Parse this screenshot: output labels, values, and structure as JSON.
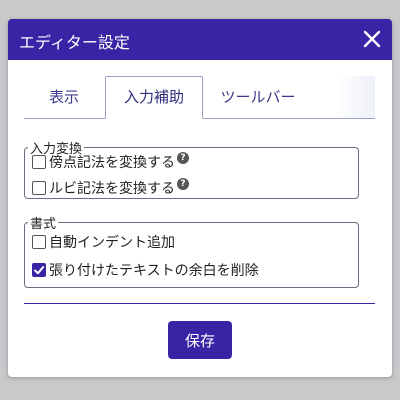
{
  "dialog": {
    "title": "エディター設定",
    "close_icon": "close-icon"
  },
  "tabs": [
    {
      "label": "表示",
      "active": false
    },
    {
      "label": "入力補助",
      "active": true
    },
    {
      "label": "ツールバー",
      "active": false
    }
  ],
  "input_conversion": {
    "legend": "入力変換",
    "options": [
      {
        "label": "傍点記法を変換する",
        "checked": false,
        "help": "?"
      },
      {
        "label": "ルビ記法を変換する",
        "checked": false,
        "help": "?"
      }
    ]
  },
  "formatting": {
    "legend": "書式",
    "options": [
      {
        "label": "自動インデント追加",
        "checked": false
      },
      {
        "label": "張り付けたテキストの余白を削除",
        "checked": true
      }
    ]
  },
  "footer": {
    "save_label": "保存"
  },
  "colors": {
    "accent": "#3725a5",
    "backdrop": "#c9c9cc"
  }
}
